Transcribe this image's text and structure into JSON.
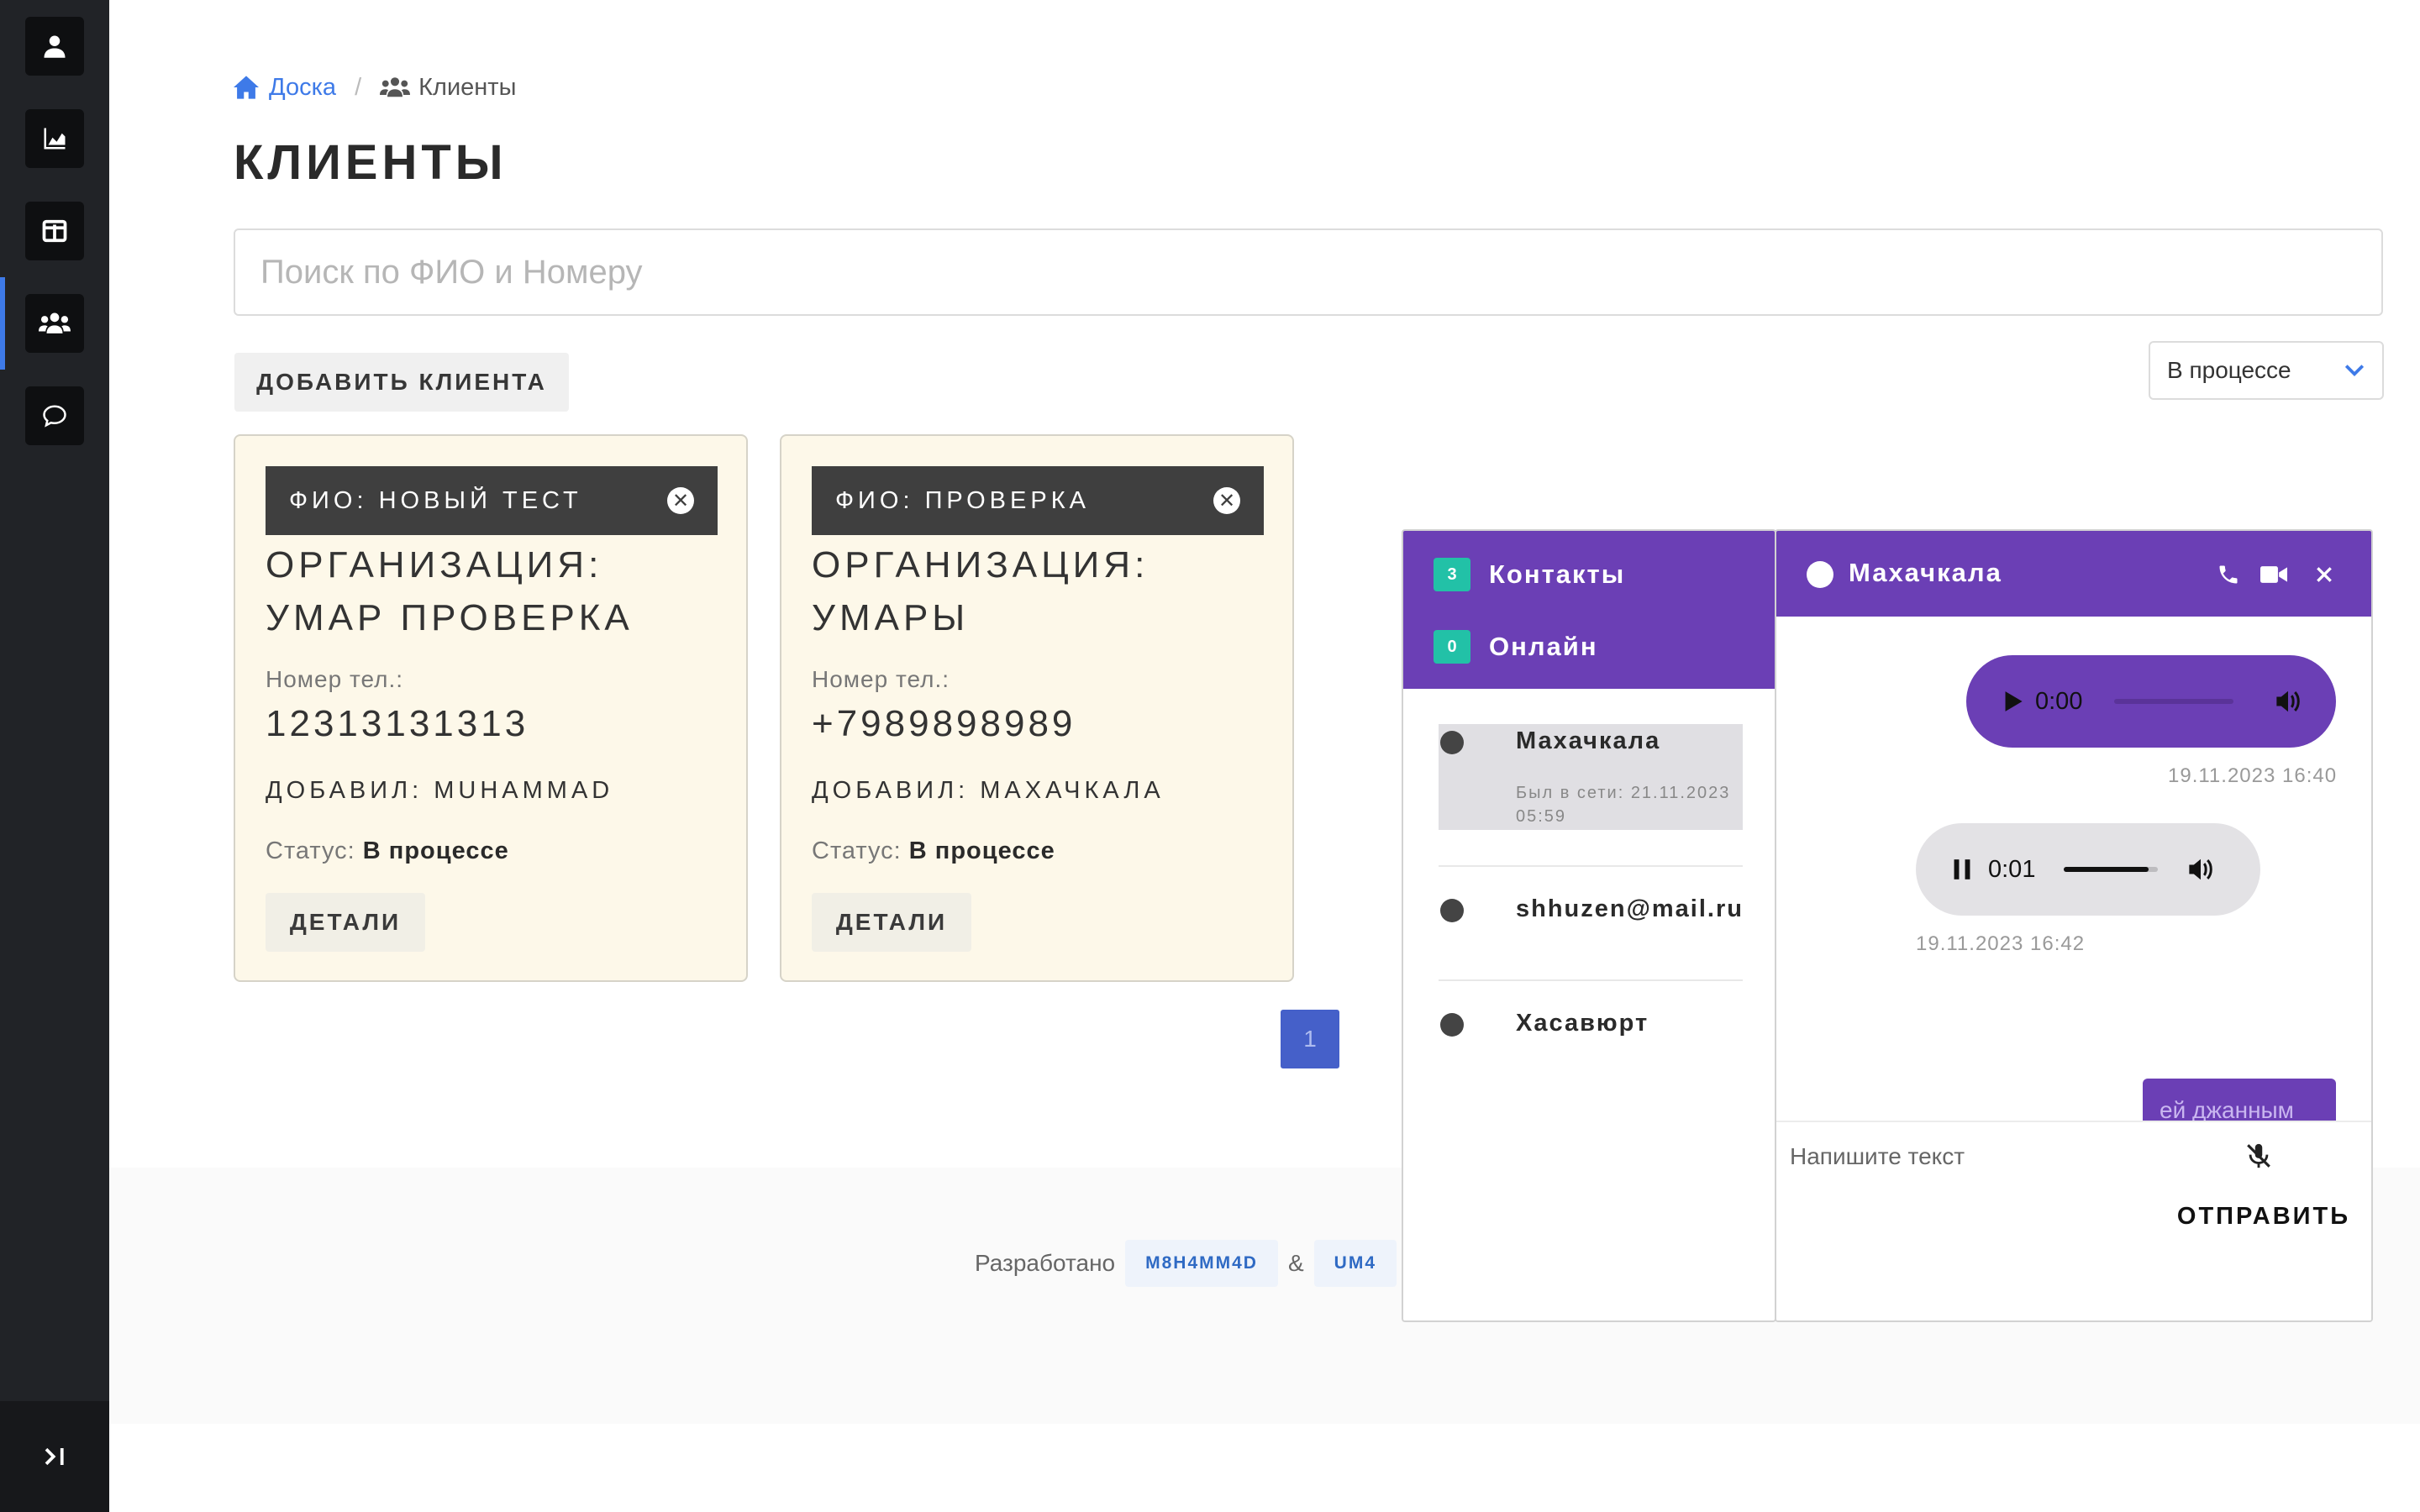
{
  "breadcrumb": {
    "home": "Доска",
    "separator": "/",
    "current": "Клиенты"
  },
  "page": {
    "title": "КЛИЕНТЫ"
  },
  "search": {
    "placeholder": "Поиск по ФИО и Номеру",
    "value": ""
  },
  "toolbar": {
    "add_client": "ДОБАВИТЬ КЛИЕНТА",
    "status_filter": "В процессе"
  },
  "cards": [
    {
      "fio": "ФИО: НОВЫЙ ТЕСТ",
      "org": "ОРГАНИЗАЦИЯ: УМАР ПРОВЕРКА",
      "phone_label": "Номер тел.:",
      "phone": "12313131313",
      "added_by": "ДОБАВИЛ: MUHAMMAD",
      "status_label": "Статус:",
      "status": "В процессе",
      "details": "ДЕТАЛИ"
    },
    {
      "fio": "ФИО: ПРОВЕРКА",
      "org": "ОРГАНИЗАЦИЯ: УМАРЫ",
      "phone_label": "Номер тел.:",
      "phone": "+7989898989",
      "added_by": "ДОБАВИЛ: МАХАЧКАЛА",
      "status_label": "Статус:",
      "status": "В процессе",
      "details": "ДЕТАЛИ"
    }
  ],
  "pagination": {
    "current": "1"
  },
  "footer": {
    "text": "Разработано",
    "author1": "M8H4MM4D",
    "amp": "&",
    "author2": "UM4"
  },
  "contacts_panel": {
    "contacts_count": "3",
    "contacts_label": "Контакты",
    "online_count": "0",
    "online_label": "Онлайн",
    "items": [
      {
        "name": "Махачкала",
        "meta": "Был в сети: 21.11.2023 05:59"
      },
      {
        "name": "shhuzen@mail.ru"
      },
      {
        "name": "Хасавюрт"
      }
    ]
  },
  "chat": {
    "title": "Махачкала",
    "messages": [
      {
        "type": "audio",
        "time": "0:00",
        "progress": 0.0,
        "timestamp": "19.11.2023 16:40"
      },
      {
        "type": "audio",
        "time": "0:01",
        "progress": 0.9,
        "timestamp": "19.11.2023 16:42"
      }
    ],
    "partial_text": "ей джанным",
    "input_placeholder": "Напишите текст",
    "send": "ОТПРАВИТЬ"
  },
  "colors": {
    "sidebar": "#212327",
    "accent": "#3e7ae8",
    "chat_purple": "#6b3fb5",
    "badge": "#22c1a7",
    "card_bg": "#fdf8e9",
    "page_btn": "#4560c9"
  },
  "icons": {
    "sidebar": [
      "user-icon",
      "chart-icon",
      "layout-icon",
      "users-icon",
      "chat-icon"
    ],
    "collapse": "expand-icon"
  }
}
